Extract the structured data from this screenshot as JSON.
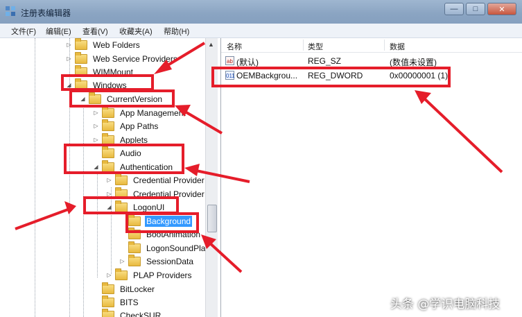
{
  "window": {
    "title": "注册表编辑器",
    "controls": [
      "—",
      "□",
      "✕"
    ]
  },
  "menu": [
    "文件(F)",
    "编辑(E)",
    "查看(V)",
    "收藏夹(A)",
    "帮助(H)"
  ],
  "tree": [
    {
      "label": "Web Folders",
      "expander": "▷"
    },
    {
      "label": "Web Service Providers",
      "expander": "▷"
    },
    {
      "label": "WIMMount",
      "expander": ""
    },
    {
      "label": "Windows",
      "expander": "◢"
    },
    {
      "label": "CurrentVersion",
      "expander": "◢"
    },
    {
      "label": "App Management",
      "expander": "▷"
    },
    {
      "label": "App Paths",
      "expander": "▷"
    },
    {
      "label": "Applets",
      "expander": "▷"
    },
    {
      "label": "Audio",
      "expander": ""
    },
    {
      "label": "Authentication",
      "expander": "◢"
    },
    {
      "label": "Credential Provider",
      "expander": "▷"
    },
    {
      "label": "Credential Provider",
      "expander": "▷"
    },
    {
      "label": "LogonUI",
      "expander": "◢"
    },
    {
      "label": "Background",
      "expander": "",
      "selected": true
    },
    {
      "label": "BootAnimation",
      "expander": ""
    },
    {
      "label": "LogonSoundPla",
      "expander": ""
    },
    {
      "label": "SessionData",
      "expander": "▷"
    },
    {
      "label": "PLAP Providers",
      "expander": "▷"
    },
    {
      "label": "BitLocker",
      "expander": ""
    },
    {
      "label": "BITS",
      "expander": ""
    },
    {
      "label": "CheckSUR",
      "expander": ""
    }
  ],
  "list": {
    "columns": [
      "名称",
      "类型",
      "数据"
    ],
    "rows": [
      {
        "name": "(默认)",
        "type": "REG_SZ",
        "data": "(数值未设置)",
        "icon": "ab"
      },
      {
        "name": "OEMBackgrou...",
        "type": "REG_DWORD",
        "data": "0x00000001 (1)",
        "icon": "011"
      }
    ]
  },
  "annotation_color": "#e51d2a",
  "watermark": "头条 @学识电脑科技"
}
